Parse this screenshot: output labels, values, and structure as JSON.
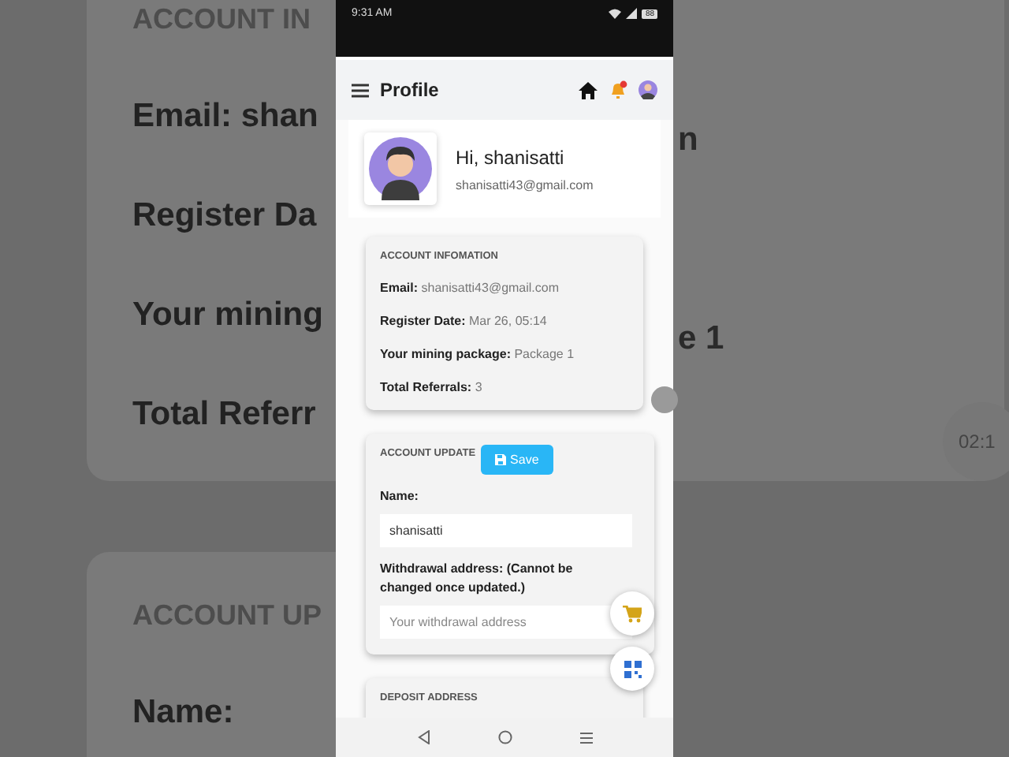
{
  "background": {
    "left_heading": "ACCOUNT IN",
    "left_rows": [
      "Email: shan",
      "Register Da",
      "Your mining",
      "Total Referr"
    ],
    "left_heading_2": "ACCOUNT UP",
    "left_row_2": "Name:",
    "right_rows": [
      "n",
      "",
      "e 1"
    ],
    "timer": "02:1"
  },
  "status_bar": {
    "time": "9:31 AM",
    "battery": "88"
  },
  "app_bar": {
    "title": "Profile",
    "notification": true
  },
  "profile": {
    "greeting": "Hi, shanisatti",
    "email": "shanisatti43@gmail.com"
  },
  "account_info": {
    "heading": "ACCOUNT INFOMATION",
    "rows": [
      {
        "label": "Email:",
        "value": "shanisatti43@gmail.com"
      },
      {
        "label": "Register Date:",
        "value": "Mar 26, 05:14"
      },
      {
        "label": "Your mining package:",
        "value": "Package 1"
      },
      {
        "label": "Total Referrals:",
        "value": "3"
      }
    ]
  },
  "account_update": {
    "heading": "ACCOUNT UPDATE",
    "save_button": "Save",
    "fields": [
      {
        "label": "Name:",
        "value": "shanisatti"
      },
      {
        "label": "Withdrawal address: (Cannot be changed once updated.)",
        "placeholder": "Your withdrawal address"
      }
    ]
  },
  "deposit": {
    "heading": "DEPOSIT ADDRESS"
  }
}
